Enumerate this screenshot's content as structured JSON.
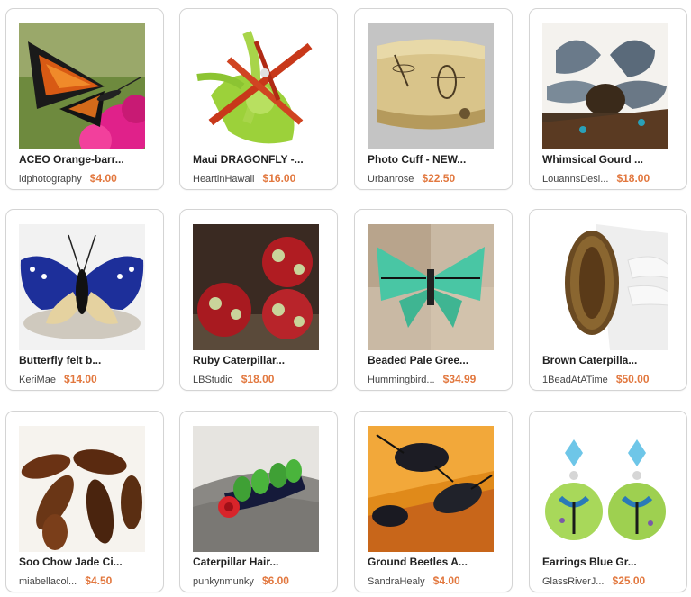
{
  "listings": [
    {
      "title": "ACEO Orange-barr...",
      "shop": "ldphotography",
      "price": "$4.00",
      "image_icon": "butterfly-photo"
    },
    {
      "title": "Maui DRAGONFLY -...",
      "shop": "HeartinHawaii",
      "price": "$16.00",
      "image_icon": "dragonfly-photo"
    },
    {
      "title": "Photo Cuff - NEW...",
      "shop": "Urbanrose",
      "price": "$22.50",
      "image_icon": "cuff-photo"
    },
    {
      "title": "Whimsical Gourd ...",
      "shop": "LouannsDesi...",
      "price": "$18.00",
      "image_icon": "gourd-photo"
    },
    {
      "title": "Butterfly felt b...",
      "shop": "KeriMae",
      "price": "$14.00",
      "image_icon": "felt-butterfly-photo"
    },
    {
      "title": "Ruby Caterpillar...",
      "shop": "LBStudio",
      "price": "$18.00",
      "image_icon": "beads-photo"
    },
    {
      "title": "Beaded Pale Gree...",
      "shop": "Hummingbird...",
      "price": "$34.99",
      "image_icon": "beaded-butterfly-photo"
    },
    {
      "title": "Brown Caterpilla...",
      "shop": "1BeadAtATime",
      "price": "$50.00",
      "image_icon": "bracelet-photo"
    },
    {
      "title": "Soo Chow Jade Ci...",
      "shop": "miabellacol...",
      "price": "$4.50",
      "image_icon": "cicadas-photo"
    },
    {
      "title": "Caterpillar Hair...",
      "shop": "punkynmunky",
      "price": "$6.00",
      "image_icon": "hairclip-photo"
    },
    {
      "title": "Ground Beetles A...",
      "shop": "SandraHealy",
      "price": "$4.00",
      "image_icon": "beetles-photo"
    },
    {
      "title": "Earrings Blue Gr...",
      "shop": "GlassRiverJ...",
      "price": "$25.00",
      "image_icon": "earrings-photo"
    }
  ],
  "colors": {
    "price": "#e2783f",
    "border": "#d4d4d4",
    "title": "#222222"
  }
}
